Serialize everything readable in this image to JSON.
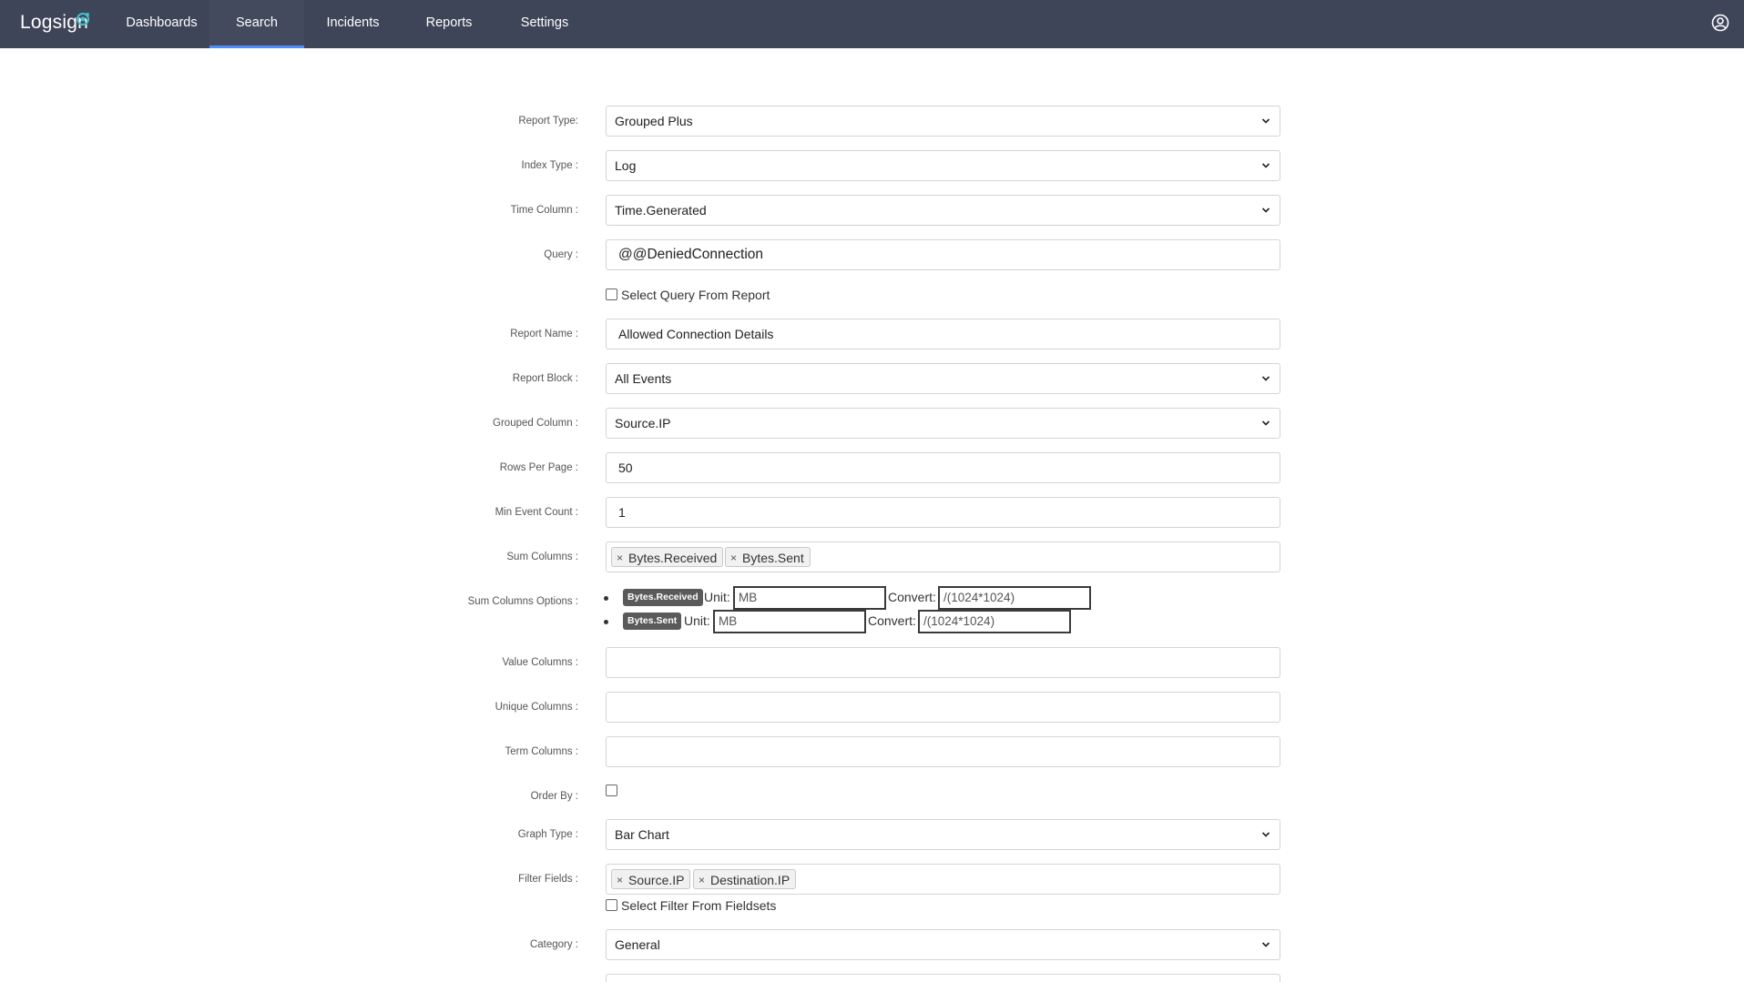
{
  "nav": {
    "logo": "Logsign",
    "items": [
      {
        "label": "Dashboards"
      },
      {
        "label": "Search"
      },
      {
        "label": "Incidents"
      },
      {
        "label": "Reports"
      },
      {
        "label": "Settings"
      }
    ],
    "active": "Search",
    "user_icon": "user-circle-icon"
  },
  "form": {
    "report_type": {
      "label": "Report Type:",
      "value": "Grouped Plus"
    },
    "index_type": {
      "label": "Index Type :",
      "value": "Log"
    },
    "time_column": {
      "label": "Time Column :",
      "value": "Time.Generated"
    },
    "query": {
      "label": "Query :",
      "value": "@@DeniedConnection"
    },
    "select_query_from_report": {
      "label": "Select Query From Report",
      "checked": false
    },
    "report_name": {
      "label": "Report Name :",
      "value": "Allowed Connection Details"
    },
    "report_block": {
      "label": "Report Block :",
      "value": "All Events"
    },
    "grouped_column": {
      "label": "Grouped Column :",
      "value": "Source.IP"
    },
    "rows_per_page": {
      "label": "Rows Per Page :",
      "value": "50"
    },
    "min_event_count": {
      "label": "Min Event Count :",
      "value": "1"
    },
    "sum_columns": {
      "label": "Sum Columns :",
      "tags": [
        "Bytes.Received",
        "Bytes.Sent"
      ]
    },
    "sum_columns_options": {
      "label": "Sum Columns Options :",
      "unit_label": "Unit:",
      "convert_label": "Convert:",
      "items": [
        {
          "name": "Bytes.Received",
          "unit": "MB",
          "convert": "/(1024*1024)"
        },
        {
          "name": "Bytes.Sent",
          "unit": "MB",
          "convert": "/(1024*1024)"
        }
      ]
    },
    "value_columns": {
      "label": "Value Columns :",
      "value": ""
    },
    "unique_columns": {
      "label": "Unique Columns :",
      "value": ""
    },
    "term_columns": {
      "label": "Term Columns :",
      "value": ""
    },
    "order_by": {
      "label": "Order By :",
      "checked": false
    },
    "graph_type": {
      "label": "Graph Type :",
      "value": "Bar Chart"
    },
    "filter_fields": {
      "label": "Filter Fields :",
      "tags": [
        "Source.IP",
        "Destination.IP"
      ]
    },
    "select_filter_from_fieldsets": {
      "label": "Select Filter From Fieldsets",
      "checked": false
    },
    "category": {
      "label": "Category :",
      "value": "General"
    }
  }
}
